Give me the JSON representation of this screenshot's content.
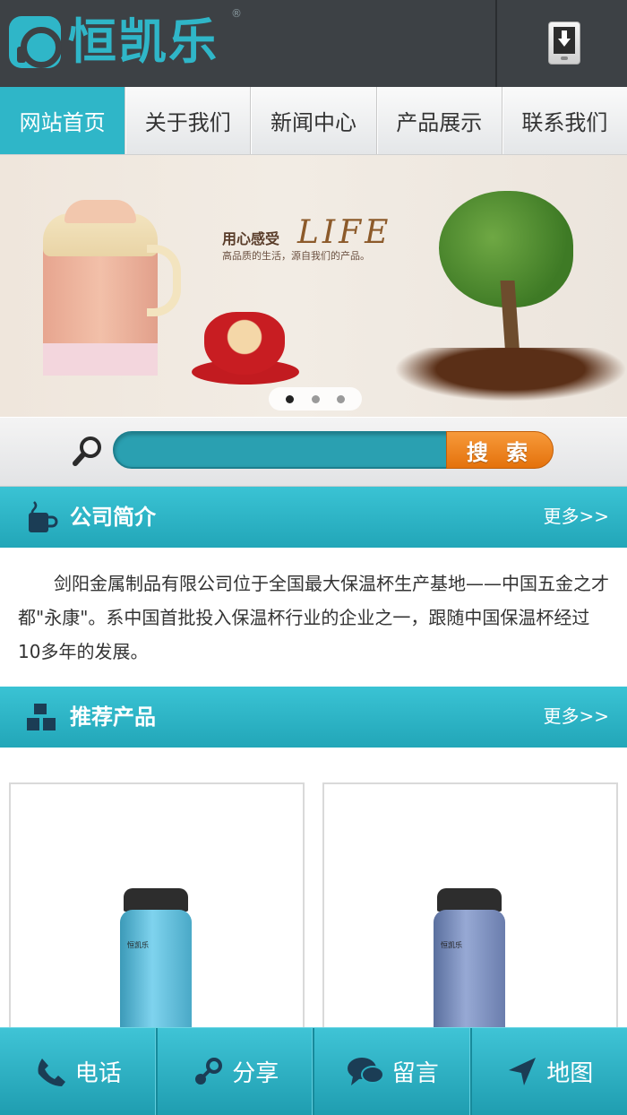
{
  "header": {
    "logo_text": "恒凯乐",
    "logo_reg": "®"
  },
  "nav": {
    "items": [
      {
        "label": "网站首页",
        "active": true
      },
      {
        "label": "关于我们"
      },
      {
        "label": "新闻中心"
      },
      {
        "label": "产品展示"
      },
      {
        "label": "联系我们"
      }
    ]
  },
  "banner": {
    "slogan": "用心感受",
    "life": "LIFE",
    "sub": "高品质的生活，源自我们的产品。",
    "slide_count": 3,
    "active_slide": 1
  },
  "search": {
    "button_label": "搜 索",
    "placeholder": ""
  },
  "intro": {
    "title": "公司简介",
    "more": "更多>>",
    "text": "剑阳金属制品有限公司位于全国最大保温杯生产基地——中国五金之才都\"永康\"。系中国首批投入保温杯行业的企业之一，跟随中国保温杯经过10多年的发展。"
  },
  "products": {
    "title": "推荐产品",
    "more": "更多>>",
    "brand_mark": "恒凯乐"
  },
  "bottom_bar": {
    "items": [
      {
        "label": "电话",
        "icon": "phone-icon"
      },
      {
        "label": "分享",
        "icon": "share-icon"
      },
      {
        "label": "留言",
        "icon": "message-icon"
      },
      {
        "label": "地图",
        "icon": "map-arrow-icon"
      }
    ]
  },
  "colors": {
    "accent": "#2fb6c8",
    "header_bg": "#3d4145",
    "search_button": "#f08a24"
  }
}
